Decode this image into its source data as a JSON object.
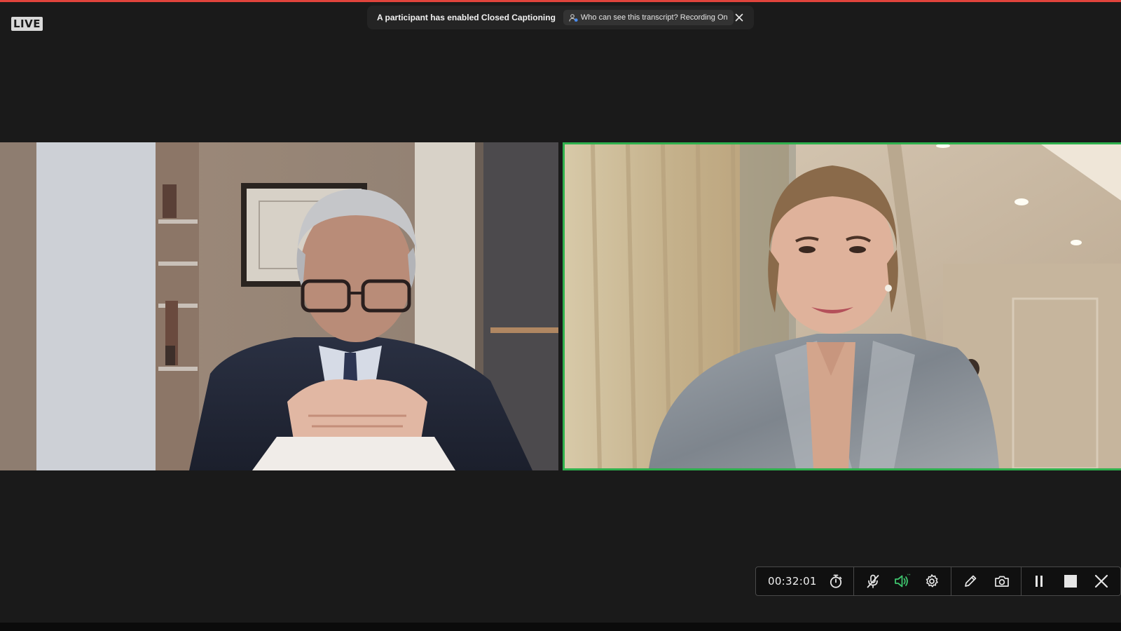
{
  "live_badge": "LIVE",
  "caption_banner": {
    "message": "A participant has enabled Closed Captioning",
    "pill_text": "Who can see this transcript? Recording On"
  },
  "participants": [
    {
      "tile": "left",
      "speaking": false
    },
    {
      "tile": "right",
      "speaking": true
    }
  ],
  "toolbar": {
    "timer": "00:32:01",
    "icons": [
      "stopwatch-icon",
      "mic-muted-icon",
      "speaker-icon",
      "gear-icon",
      "pencil-icon",
      "camera-icon",
      "pause-icon",
      "stop-icon",
      "close-icon"
    ]
  },
  "colors": {
    "recording_border": "#e0443c",
    "active_speaker_border": "#2fb04d",
    "speaker_icon": "#3ec46d",
    "background": "#1a1a1a"
  }
}
